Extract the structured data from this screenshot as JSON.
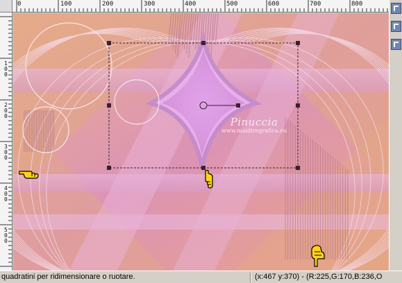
{
  "ruler_top": {
    "labels": [
      "0",
      "100",
      "200",
      "300",
      "400",
      "500",
      "600",
      "700",
      "800"
    ]
  },
  "ruler_left": {
    "labels": [
      "1 0 0",
      "2 0 0",
      "3 0 0",
      "4 0 0",
      "5 0 0"
    ]
  },
  "watermark": {
    "name": "Pinuccia",
    "site": "www.maidiregrafica.eu"
  },
  "statusbar": {
    "message": "quadratini per ridimensionare o ruotare.",
    "coords": "(x:467 y:370) - (R:225,G:170,B:236,O"
  },
  "colors": {
    "canvas_base": "#d69abd",
    "stripe_pink": "#e6b6e6",
    "peach": "#e8a98a",
    "lilac": "#dda2e3",
    "selection": "#3a2030",
    "status_bg": "#d4d0c8",
    "toolbar_btn": "#6f86b5"
  },
  "icons": {
    "toolbar_buttons": [
      "palette-tool-icon",
      "layers-tool-icon",
      "overview-tool-icon"
    ],
    "cursors": [
      "pointing-hand-cursor",
      "pointing-hand-cursor",
      "pointing-hand-cursor"
    ]
  }
}
